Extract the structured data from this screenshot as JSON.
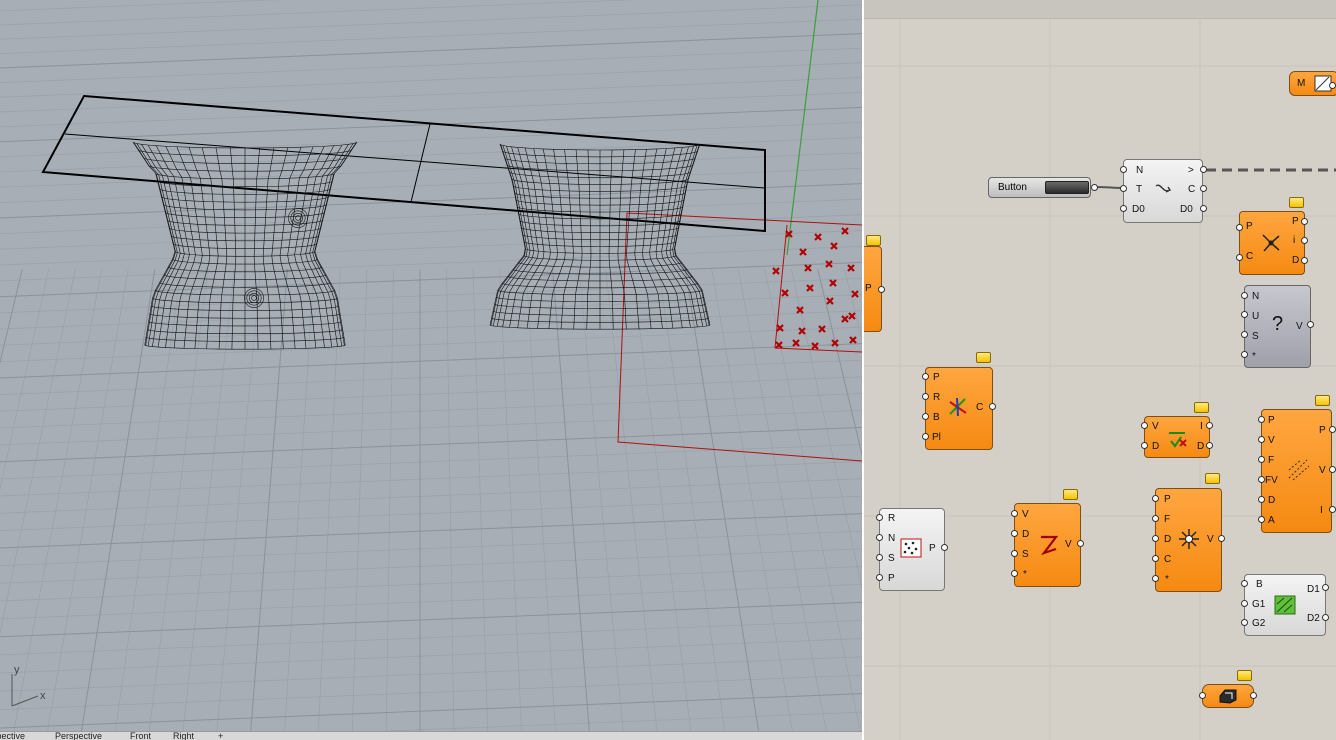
{
  "viewport": {
    "axis_labels": {
      "y": "y",
      "x": "x"
    },
    "tabs": [
      "Perspective",
      "Perspective",
      "Front",
      "Right",
      "+"
    ],
    "colors": {
      "background": "#a7aeb6",
      "wire": "#111111",
      "points": "#b00000",
      "axis_green": "#3aa03a"
    }
  },
  "canvas": {
    "components": {
      "m_param": {
        "label": "M"
      },
      "button": {
        "label": "Button"
      },
      "datadam": {
        "inputs": [
          "N",
          "T",
          "D0"
        ],
        "outputs": [
          ">",
          "C",
          "D0"
        ]
      },
      "partial": {
        "inputs": [],
        "outputs": [
          "P"
        ]
      },
      "closest": {
        "inputs": [
          "P",
          "C"
        ],
        "outputs": [
          "P",
          "i",
          "D"
        ]
      },
      "query": {
        "inputs": [
          "N",
          "U",
          "S",
          "*"
        ],
        "outputs": [
          "V"
        ]
      },
      "circle": {
        "inputs": [
          "P",
          "R",
          "B",
          "Pl"
        ],
        "outputs": [
          "C"
        ]
      },
      "vec_display": {
        "inputs": [
          "V",
          "D"
        ],
        "outputs": [
          "I",
          "D"
        ]
      },
      "field_disp": {
        "inputs": [
          "P",
          "V",
          "F",
          "FV",
          "D",
          "A"
        ],
        "outputs": [
          "P",
          "V",
          "I"
        ]
      },
      "populate": {
        "inputs": [
          "R",
          "N",
          "S",
          "P"
        ],
        "outputs": [
          "P"
        ]
      },
      "vec_field": {
        "inputs": [
          "V",
          "D",
          "S",
          "*"
        ],
        "outputs": [
          "V"
        ]
      },
      "point_charge": {
        "inputs": [
          "P",
          "F",
          "D",
          "C",
          "*"
        ],
        "outputs": [
          "V"
        ]
      },
      "blend": {
        "inputs": [
          "B",
          "G1",
          "G2"
        ],
        "outputs": [
          "D1",
          "D2"
        ]
      },
      "brep_param": {
        "label": ""
      }
    }
  }
}
